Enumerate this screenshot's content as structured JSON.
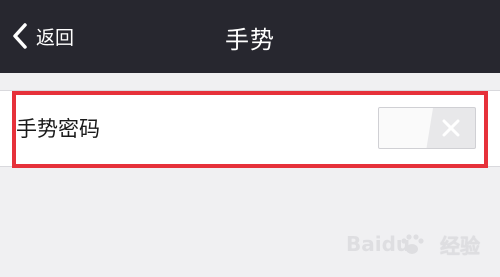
{
  "nav": {
    "back_label": "返回",
    "title": "手势"
  },
  "settings": {
    "gesture_password": {
      "label": "手势密码",
      "enabled": false
    }
  },
  "icons": {
    "back": "chevron-left-icon",
    "toggle_off": "close-icon",
    "watermark": "baidu-paw-icon"
  },
  "colors": {
    "nav_bg": "#27272f",
    "highlight": "#e6313a",
    "page_bg": "#f0f0f2"
  },
  "watermark": {
    "logo_text": "Baidu",
    "text": "经验"
  }
}
